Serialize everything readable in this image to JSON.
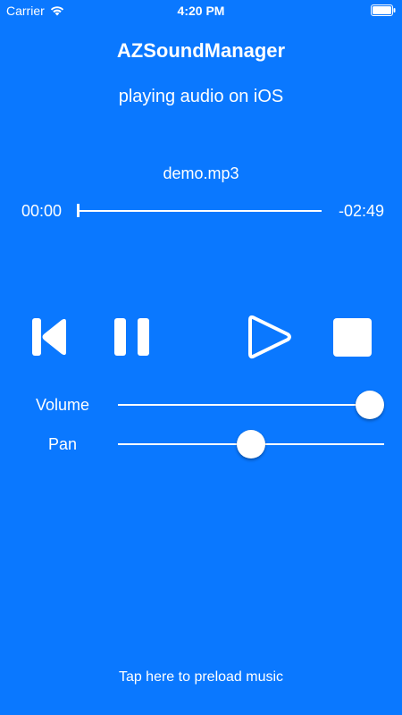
{
  "status_bar": {
    "carrier": "Carrier",
    "time": "4:20 PM",
    "icons": [
      "wifi-icon",
      "battery-icon"
    ]
  },
  "header": {
    "title": "AZSoundManager",
    "subtitle": "playing audio on iOS"
  },
  "player": {
    "track_name": "demo.mp3",
    "elapsed": "00:00",
    "remaining": "-02:49",
    "progress_fraction": 0.0,
    "controls": [
      {
        "name": "previous",
        "icon": "skip-back-icon"
      },
      {
        "name": "pause",
        "icon": "pause-icon"
      },
      {
        "name": "play",
        "icon": "play-icon"
      },
      {
        "name": "stop",
        "icon": "stop-icon"
      }
    ]
  },
  "sliders": {
    "volume": {
      "label": "Volume",
      "value": 1.0
    },
    "pan": {
      "label": "Pan",
      "value": 0.5
    }
  },
  "footer": {
    "preload_label": "Tap here to preload music"
  },
  "colors": {
    "background": "#0a78ff",
    "foreground": "#ffffff"
  }
}
